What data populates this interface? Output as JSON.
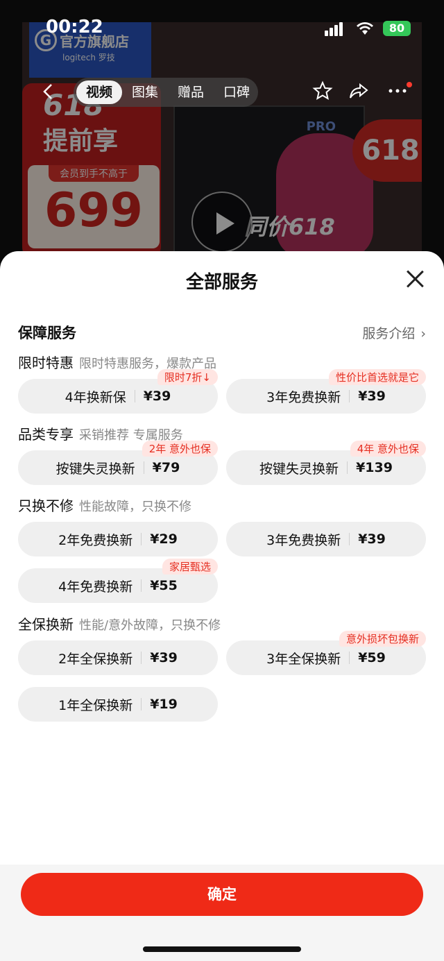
{
  "status_bar": {
    "time": "00:22",
    "battery": "80"
  },
  "background": {
    "store_name": "官方旗舰店",
    "store_brand": "logitech 罗技",
    "promo_title_1": "618",
    "promo_title_2": "提前享",
    "member_label": "会员到手不高于",
    "price": "699",
    "badge_618": "618",
    "box_label": "PRO",
    "promo_bottom": "同价618"
  },
  "nav": {
    "tabs": [
      "视频",
      "图集",
      "赠品",
      "口碑"
    ],
    "active_tab": 0
  },
  "sheet": {
    "title": "全部服务",
    "section_title": "保障服务",
    "service_intro": "服务介绍",
    "groups": [
      {
        "title": "限时特惠",
        "desc": "限时特惠服务，爆款产品",
        "items": [
          {
            "name": "4年换新保",
            "price": "¥39",
            "badge": "限时7折↓"
          },
          {
            "name": "3年免费换新",
            "price": "¥39",
            "badge": "性价比首选就是它"
          }
        ]
      },
      {
        "title": "品类专享",
        "desc": "采销推荐 专属服务",
        "items": [
          {
            "name": "按键失灵换新",
            "price": "¥79",
            "badge": "2年 意外也保"
          },
          {
            "name": "按键失灵换新",
            "price": "¥139",
            "badge": "4年 意外也保"
          }
        ]
      },
      {
        "title": "只换不修",
        "desc": "性能故障，只换不修",
        "items": [
          {
            "name": "2年免费换新",
            "price": "¥29",
            "badge": ""
          },
          {
            "name": "3年免费换新",
            "price": "¥39",
            "badge": ""
          },
          {
            "name": "4年免费换新",
            "price": "¥55",
            "badge": "家居甄选"
          }
        ]
      },
      {
        "title": "全保换新",
        "desc": "性能/意外故障，只换不修",
        "items": [
          {
            "name": "2年全保换新",
            "price": "¥39",
            "badge": ""
          },
          {
            "name": "3年全保换新",
            "price": "¥59",
            "badge": "意外损坏包换新"
          },
          {
            "name": "1年全保换新",
            "price": "¥19",
            "badge": ""
          }
        ]
      }
    ],
    "confirm_label": "确定"
  }
}
